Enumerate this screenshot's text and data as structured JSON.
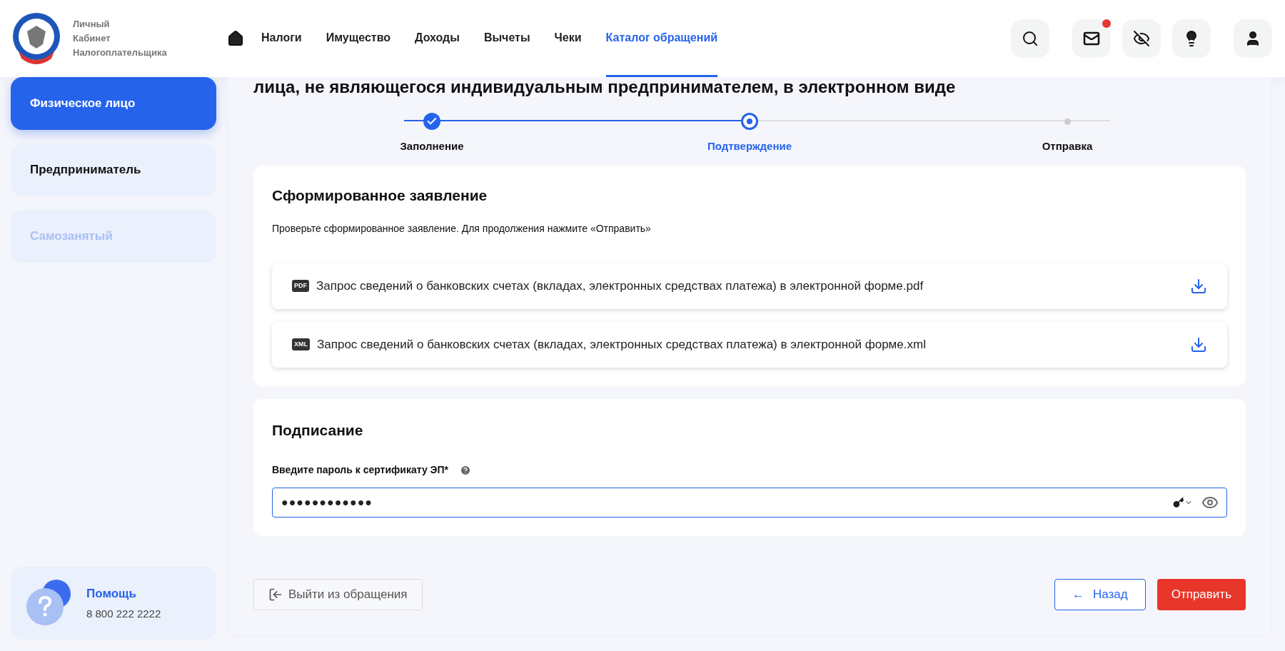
{
  "brand": {
    "lines": [
      "Личный",
      "Кабинет",
      "Налогоплательщика"
    ]
  },
  "nav": [
    {
      "label": "Налоги",
      "selected": false
    },
    {
      "label": "Имущество",
      "selected": false
    },
    {
      "label": "Доходы",
      "selected": false
    },
    {
      "label": "Вычеты",
      "selected": false
    },
    {
      "label": "Чеки",
      "selected": false
    },
    {
      "label": "Каталог обращений",
      "selected": true
    }
  ],
  "header_actions": [
    {
      "kind": "search",
      "badge": false
    },
    {
      "kind": "mail",
      "badge": true
    },
    {
      "kind": "eye-off",
      "badge": false
    },
    {
      "kind": "bulb",
      "badge": false
    },
    {
      "kind": "user",
      "badge": false
    }
  ],
  "sidebar": {
    "items": [
      {
        "label": "Физическое лицо",
        "selected": true,
        "disabled": false
      },
      {
        "label": "Предприниматель",
        "selected": false,
        "disabled": false
      },
      {
        "label": "Самозанятый",
        "selected": false,
        "disabled": true
      }
    ],
    "help": {
      "title": "Помощь",
      "phone": "8 800 222 2222"
    }
  },
  "page_title": "лица, не являющегося индивидуальным предпринимателем, в электронном виде",
  "steps": [
    {
      "label": "Заполнение",
      "done": true,
      "selected": false
    },
    {
      "label": "Подтверждение",
      "done": false,
      "selected": true
    },
    {
      "label": "Отправка",
      "done": false,
      "selected": false
    }
  ],
  "document_card": {
    "title": "Сформированное заявление",
    "hint": "Проверьте сформированное заявление. Для продолжения нажмите «Отправить»",
    "files": [
      {
        "type": "PDF",
        "name": "Запрос сведений о банковских счетах (вкладах, электронных средствах платежа) в электронной форме.pdf"
      },
      {
        "type": "XML",
        "name": "Запрос сведений о банковских счетах (вкладах, электронных средствах платежа) в электронной форме.xml"
      }
    ]
  },
  "signing_card": {
    "title": "Подписание",
    "label": "Введите пароль к сертификату ЭП*",
    "value": "●●●●●●●●●●●●"
  },
  "buttons": {
    "exit": "Выйти из обращения",
    "back": "Назад",
    "back_arrow": "←",
    "submit": "Отправить"
  }
}
